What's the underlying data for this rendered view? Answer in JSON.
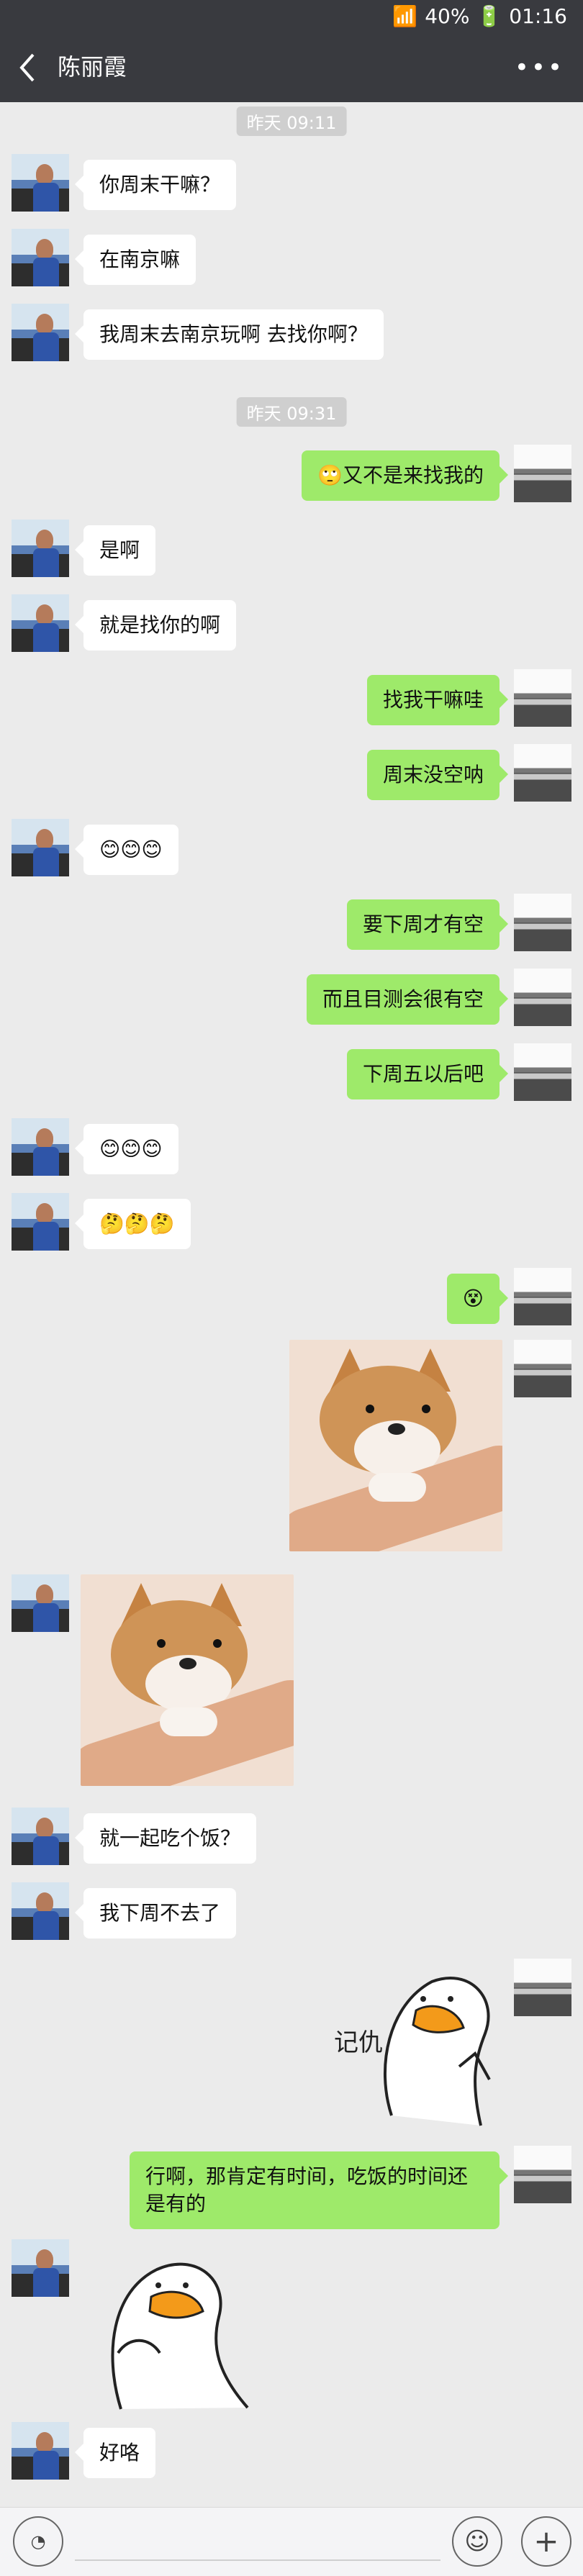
{
  "status_bar": {
    "battery": "40%",
    "time": "01:16"
  },
  "header": {
    "title": "陈丽霞"
  },
  "chat": {
    "timestamps": [
      "昨天 09:11",
      "昨天 09:31"
    ],
    "messages": [
      {
        "side": "left",
        "text": "你周末干嘛？"
      },
      {
        "side": "left",
        "text": "在南京嘛"
      },
      {
        "side": "left",
        "text": "我周末去南京玩啊 去找你啊？"
      },
      {
        "side": "right",
        "text": "🙄又不是来找我的"
      },
      {
        "side": "left",
        "text": "是啊"
      },
      {
        "side": "left",
        "text": "就是找你的啊"
      },
      {
        "side": "right",
        "text": "找我干嘛哇"
      },
      {
        "side": "right",
        "text": "周末没空呐"
      },
      {
        "side": "left",
        "text": "😊😊😊"
      },
      {
        "side": "right",
        "text": "要下周才有空"
      },
      {
        "side": "right",
        "text": "而且目测会很有空"
      },
      {
        "side": "right",
        "text": "下周五以后吧"
      },
      {
        "side": "left",
        "text": "😊😊😊"
      },
      {
        "side": "left",
        "text": "🤔🤔🤔"
      },
      {
        "side": "right",
        "text": "😵"
      },
      {
        "side": "left",
        "text": "就一起吃个饭？"
      },
      {
        "side": "left",
        "text": "我下周不去了"
      },
      {
        "side": "right",
        "text": "行啊，那肯定有时间，吃饭的时间还是有的"
      },
      {
        "side": "left",
        "text": "好咯"
      }
    ],
    "sticker_text": "记仇"
  }
}
